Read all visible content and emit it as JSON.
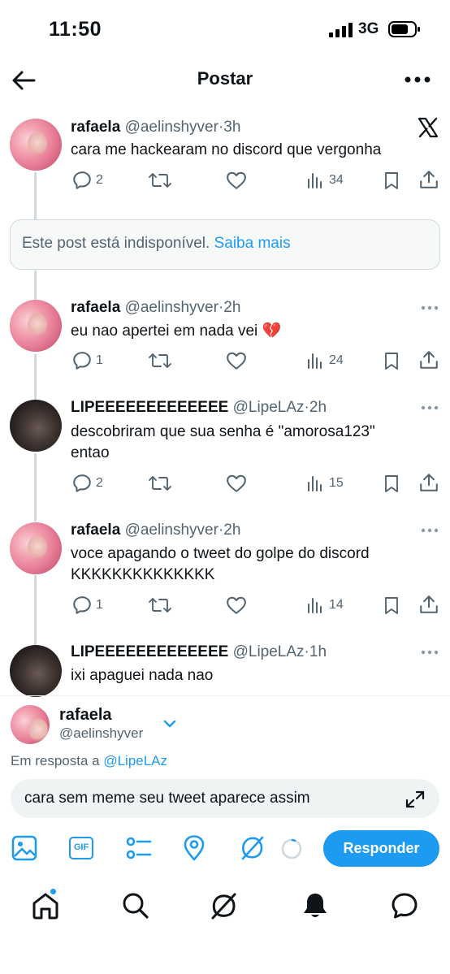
{
  "status_bar": {
    "time": "11:50",
    "network": "3G"
  },
  "header": {
    "title": "Postar"
  },
  "unavailable": {
    "text": "Este post está indisponível.",
    "link": "Saiba mais"
  },
  "posts": [
    {
      "name": "rafaela",
      "handle": "@aelinshyver",
      "time": "3h",
      "text": "cara me hackearam no discord que vergonha",
      "replies": "2",
      "views": "34"
    },
    {
      "name": "rafaela",
      "handle": "@aelinshyver",
      "time": "2h",
      "text": "eu nao apertei em nada vei 💔",
      "replies": "1",
      "views": "24"
    },
    {
      "name": "LIPEEEEEEEEEEEEE",
      "handle": "@LipeLAz",
      "time": "2h",
      "text_line1": "descobriram que sua senha é \"amorosa123\"",
      "text_line2": "entao",
      "replies": "2",
      "views": "15"
    },
    {
      "name": "rafaela",
      "handle": "@aelinshyver",
      "time": "2h",
      "text_line1": "voce apagando o tweet do golpe do discord",
      "text_line2": "KKKKKKKKKKKKKK",
      "replies": "1",
      "views": "14"
    },
    {
      "name": "LIPEEEEEEEEEEEEE",
      "handle": "@LipeLAz",
      "time": "1h",
      "text": "ixi apaguei nada nao"
    }
  ],
  "composer": {
    "name": "rafaela",
    "handle": "@aelinshyver",
    "reply_prefix": "Em resposta a ",
    "reply_handle": "@LipeLAz",
    "draft": "cara sem meme seu tweet aparece assim",
    "gif_label": "GIF",
    "submit": "Responder"
  },
  "colors": {
    "accent": "#1d9bf0",
    "muted": "#536471",
    "border": "#cfd9de"
  },
  "icons": [
    "back-arrow-icon",
    "more-icon",
    "x-logo-icon",
    "reply-icon",
    "retweet-icon",
    "like-icon",
    "views-icon",
    "bookmark-icon",
    "share-icon",
    "image-icon",
    "gif-icon",
    "poll-icon",
    "location-icon",
    "grok-icon",
    "home-icon",
    "search-icon",
    "bell-icon",
    "messages-icon"
  ]
}
